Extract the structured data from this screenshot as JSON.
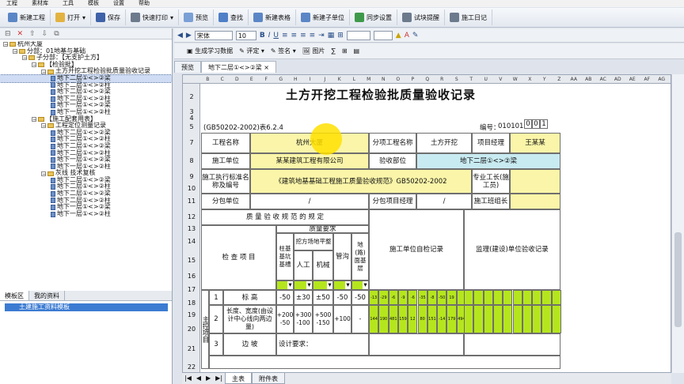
{
  "menu": [
    "工程",
    "素材库",
    "工具",
    "模板",
    "设置",
    "帮助"
  ],
  "toolbar": [
    {
      "label": "新建工程",
      "icon": "new-project-icon",
      "color": "#5b86c6"
    },
    {
      "label": "打开",
      "icon": "open-folder-icon",
      "color": "#e3b341"
    },
    {
      "label": "保存",
      "icon": "save-icon",
      "color": "#3f62a8"
    },
    {
      "label": "快速打印",
      "icon": "print-icon",
      "color": "#6c7a8c"
    },
    {
      "label": "预览",
      "icon": "preview-icon",
      "color": "#7aa0d6"
    },
    {
      "label": "查找",
      "icon": "search-icon",
      "color": "#4f7fc7"
    },
    {
      "label": "新建表格",
      "icon": "new-table-icon",
      "color": "#5b86c6"
    },
    {
      "label": "新建子单位",
      "icon": "new-subunit-icon",
      "color": "#5b86c6"
    },
    {
      "label": "同步设置",
      "icon": "sync-icon",
      "color": "#3e9a4a"
    },
    {
      "label": "试块提醒",
      "icon": "reminder-icon",
      "color": "#6c7a8c"
    },
    {
      "label": "施工日记",
      "icon": "diary-icon",
      "color": "#6c7a8c"
    }
  ],
  "tree": [
    {
      "depth": 0,
      "label": "杭州大厦",
      "type": "root"
    },
    {
      "depth": 1,
      "label": "分部：01地基与基础",
      "type": "folder"
    },
    {
      "depth": 2,
      "label": "子分部：【无支护土方】",
      "type": "folder"
    },
    {
      "depth": 3,
      "label": "【检验批】",
      "type": "folder"
    },
    {
      "depth": 4,
      "label": "土方开挖工程检验批质量验收记录",
      "type": "folder"
    },
    {
      "depth": 5,
      "label": "地下二层①<>②梁",
      "type": "doc",
      "selected": true
    },
    {
      "depth": 5,
      "label": "地下二层①<>②柱",
      "type": "doc"
    },
    {
      "depth": 5,
      "label": "地下二层①<>②梁",
      "type": "doc"
    },
    {
      "depth": 5,
      "label": "地下二层①<>②柱",
      "type": "doc"
    },
    {
      "depth": 5,
      "label": "地下一层①<>②梁",
      "type": "doc"
    },
    {
      "depth": 5,
      "label": "地下一层①<>②柱",
      "type": "doc"
    },
    {
      "depth": 3,
      "label": "【施工配套用表】",
      "type": "folder"
    },
    {
      "depth": 4,
      "label": "工程定位测量记录",
      "type": "folder"
    },
    {
      "depth": 5,
      "label": "地下二层①<>②梁",
      "type": "doc"
    },
    {
      "depth": 5,
      "label": "地下二层①<>②柱",
      "type": "doc"
    },
    {
      "depth": 5,
      "label": "地下二层①<>②梁",
      "type": "doc"
    },
    {
      "depth": 5,
      "label": "地下二层①<>②柱",
      "type": "doc"
    },
    {
      "depth": 5,
      "label": "地下一层①<>②梁",
      "type": "doc"
    },
    {
      "depth": 5,
      "label": "地下一层①<>②柱",
      "type": "doc"
    },
    {
      "depth": 4,
      "label": "灰线 技术复核",
      "type": "folder"
    },
    {
      "depth": 5,
      "label": "地下二层①<>②梁",
      "type": "doc"
    },
    {
      "depth": 5,
      "label": "地下二层①<>②柱",
      "type": "doc"
    },
    {
      "depth": 5,
      "label": "地下二层①<>②梁",
      "type": "doc"
    },
    {
      "depth": 5,
      "label": "地下二层①<>②柱",
      "type": "doc"
    },
    {
      "depth": 5,
      "label": "地下一层①<>②梁",
      "type": "doc"
    },
    {
      "depth": 5,
      "label": "地下一层①<>②柱",
      "type": "doc"
    }
  ],
  "left_tabs": [
    "模板区",
    "我的资料"
  ],
  "template_item": "土建施工资料模板",
  "format": {
    "font": "宋体",
    "size": "10"
  },
  "toolbar2": [
    "生成学习数据",
    "评定",
    "签名",
    "图片"
  ],
  "doc_tabs": [
    "预览",
    "地下二层①<>②梁"
  ],
  "sheet_tabs": [
    "主表",
    "附件表"
  ],
  "col_headers": [
    "B",
    "C",
    "D",
    "E",
    "F",
    "G",
    "H",
    "I",
    "J",
    "K",
    "L",
    "M",
    "N",
    "O",
    "P",
    "Q",
    "R",
    "S",
    "T",
    "U",
    "V",
    "W",
    "X",
    "Y",
    "Z",
    "AA",
    "AB",
    "AC",
    "AD",
    "AE",
    "AF",
    "AG"
  ],
  "row_headers": [
    "2",
    "3",
    "4",
    "5",
    "7",
    "8",
    "9",
    "10",
    "11",
    "12",
    "13",
    "14",
    "15",
    "16",
    "17",
    "18",
    "19",
    "20",
    "21",
    "22"
  ],
  "form": {
    "title": "土方开挖工程检验批质量验收记录",
    "std": "(GB50202-2002)表6.2.4",
    "code_label": "编号：",
    "code_prefix": "010101",
    "code_boxes": [
      "0",
      "0",
      "1"
    ],
    "project_name_label": "工程名称",
    "project_name": "杭州大厦",
    "sub_project_label": "分项工程名称",
    "sub_project": "土方开挖",
    "pm_label": "项目经理",
    "pm": "王某某",
    "builder_label": "施工单位",
    "builder": "某某建筑工程有限公司",
    "accept_part_label": "验收部位",
    "accept_part": "地下二层①<>②梁",
    "standard_label": "施工执行标准名称及编号",
    "standard": "《建筑地基基础工程施工质量验收规范》GB50202-2002",
    "foreman_label": "专业工长(施工员)",
    "sub_unit_label": "分包单位",
    "sub_unit": "/",
    "sub_pm_label": "分包项目经理",
    "sub_pm": "/",
    "team_label": "施工班组长",
    "spec_header": "质 量 验 收 规 范 的 规 定",
    "quality_req": "质量要求",
    "check_items": "检 查 项 目",
    "col_pile": "柱基基坑基槽",
    "col_field": "挖方场地平整",
    "col_manual": "人工",
    "col_machine": "机械",
    "col_pipe": "管沟",
    "col_road": "地(路)面基层",
    "self_check": "施工单位自检记录",
    "supervision": "监理(建设)单位验收记录",
    "main_label": "主控项目",
    "rows": [
      {
        "no": "1",
        "name": "标  高",
        "vals": [
          "-50",
          "±30",
          "±50",
          "-50",
          "-50"
        ],
        "checks": [
          "-13",
          "-29",
          "-6",
          "-9",
          "-6",
          "-35",
          "-8",
          "-50",
          "19"
        ]
      },
      {
        "no": "2",
        "name": "长度、宽度(由设计中心线向两边量)",
        "vals": [
          "+200\n-50",
          "+300\n-100",
          "+500\n-150",
          "+100",
          "-"
        ],
        "checks": [
          "144",
          "190",
          "481",
          "159",
          "12",
          "80",
          "151",
          "-14",
          "179",
          "494"
        ]
      },
      {
        "no": "3",
        "name": "边  坡",
        "design": "设计要求："
      }
    ]
  }
}
